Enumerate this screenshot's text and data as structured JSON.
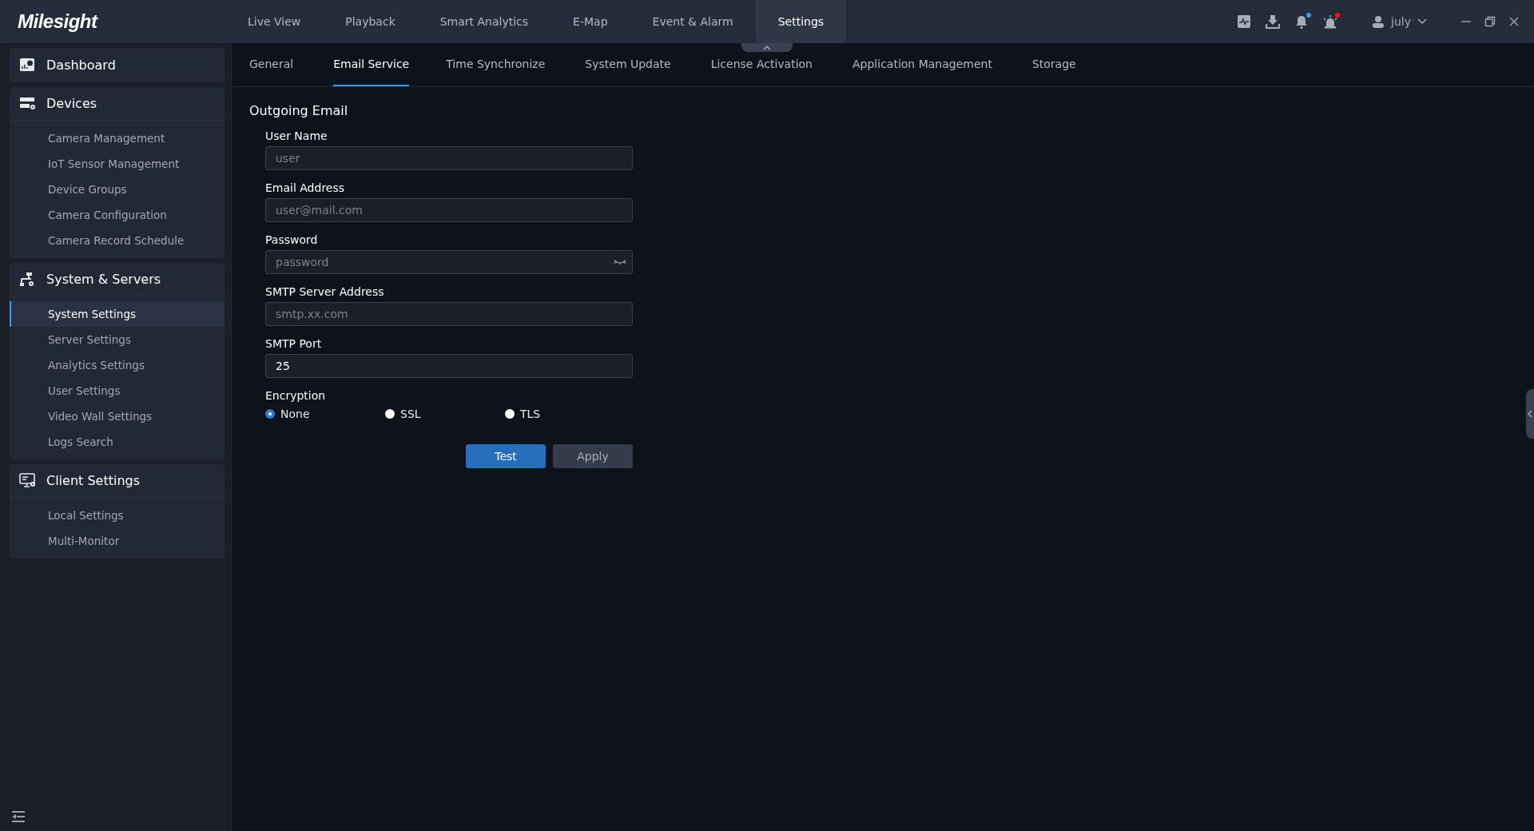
{
  "app": {
    "logo": "Milesight"
  },
  "nav": [
    {
      "label": "Live View",
      "selected": false
    },
    {
      "label": "Playback",
      "selected": false
    },
    {
      "label": "Smart Analytics",
      "selected": false
    },
    {
      "label": "E-Map",
      "selected": false
    },
    {
      "label": "Event & Alarm",
      "selected": false
    },
    {
      "label": "Settings",
      "selected": true
    }
  ],
  "toolbar_icons": [
    {
      "kind": "activity"
    },
    {
      "kind": "download"
    },
    {
      "kind": "bell",
      "color": "#3b9cf4"
    },
    {
      "kind": "alarm",
      "color": "#ff1010"
    }
  ],
  "user": {
    "name": "july"
  },
  "sidebar": {
    "sections": [
      {
        "kind": "dashboard",
        "title": "Dashboard"
      },
      {
        "kind": "devices",
        "title": "Devices",
        "items": [
          {
            "label": "Camera Management",
            "selected": false
          },
          {
            "label": "IoT Sensor Management",
            "selected": false
          },
          {
            "label": "Device Groups",
            "selected": false
          },
          {
            "label": "Camera Configuration",
            "selected": false
          },
          {
            "label": "Camera Record Schedule",
            "selected": false
          }
        ]
      },
      {
        "kind": "system",
        "title": "System & Servers",
        "items": [
          {
            "label": "System Settings",
            "selected": true
          },
          {
            "label": "Server Settings",
            "selected": false
          },
          {
            "label": "Analytics Settings",
            "selected": false
          },
          {
            "label": "User Settings",
            "selected": false
          },
          {
            "label": "Video Wall Settings",
            "selected": false
          },
          {
            "label": "Logs Search",
            "selected": false
          }
        ]
      },
      {
        "kind": "client",
        "title": "Client Settings",
        "items": [
          {
            "label": "Local Settings",
            "selected": false
          },
          {
            "label": "Multi-Monitor",
            "selected": false
          }
        ]
      }
    ]
  },
  "tabs": [
    {
      "label": "General",
      "selected": false
    },
    {
      "label": "Email Service",
      "selected": true
    },
    {
      "label": "Time Synchronize",
      "selected": false
    },
    {
      "label": "System Update",
      "selected": false
    },
    {
      "label": "License Activation",
      "selected": false
    },
    {
      "label": "Application Management",
      "selected": false
    },
    {
      "label": "Storage",
      "selected": false
    }
  ],
  "form": {
    "title": "Outgoing Email",
    "fields": [
      {
        "kind": "text",
        "label": "User Name",
        "placeholder": "user"
      },
      {
        "kind": "text",
        "label": "Email Address",
        "placeholder": "user@mail.com"
      },
      {
        "kind": "password",
        "label": "Password",
        "placeholder": "password"
      },
      {
        "kind": "text",
        "label": "SMTP Server Address",
        "placeholder": "smtp.xx.com"
      },
      {
        "kind": "text",
        "label": "SMTP Port",
        "value": "25"
      }
    ],
    "encryption": {
      "label": "Encryption",
      "options": [
        {
          "label": "None",
          "selected": true
        },
        {
          "label": "SSL",
          "selected": false
        },
        {
          "label": "TLS",
          "selected": false
        }
      ]
    },
    "buttons": [
      {
        "kind": "primary",
        "label": "Test"
      },
      {
        "kind": "secondary",
        "label": "Apply"
      }
    ]
  }
}
